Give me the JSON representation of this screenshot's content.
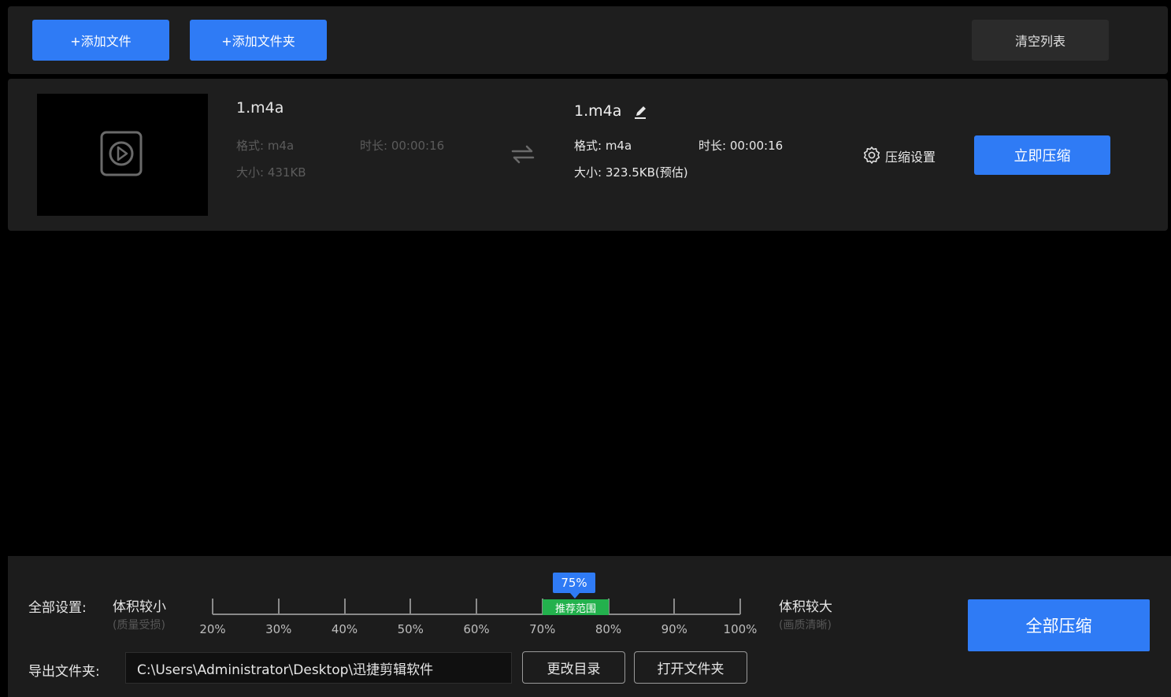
{
  "toolbar": {
    "add_file_label": "+添加文件",
    "add_folder_label": "+添加文件夹",
    "clear_list_label": "清空列表"
  },
  "file": {
    "source": {
      "name": "1.m4a",
      "format": "格式: m4a",
      "duration": "时长: 00:00:16",
      "size": "大小: 431KB"
    },
    "output": {
      "name": "1.m4a",
      "format": "格式: m4a",
      "duration": "时长: 00:00:16",
      "size": "大小: 323.5KB(预估)"
    },
    "compress_settings_label": "压缩设置",
    "compress_now_label": "立即压缩"
  },
  "bottom": {
    "all_settings_label": "全部设置:",
    "left_end_label": "体积较小",
    "left_end_sub": "(质量受损)",
    "right_end_label": "体积较大",
    "right_end_sub": "(画质清晰)",
    "slider": {
      "ticks": [
        "20%",
        "30%",
        "40%",
        "50%",
        "60%",
        "70%",
        "80%",
        "90%",
        "100%"
      ],
      "value_label": "75%",
      "value": 75,
      "recommended_label": "推荐范围"
    },
    "export_folder_label": "导出文件夹:",
    "export_path": "C:\\Users\\Administrator\\Desktop\\迅捷剪辑软件",
    "change_dir_label": "更改目录",
    "open_folder_label": "打开文件夹",
    "compress_all_label": "全部压缩"
  },
  "colors": {
    "accent": "#2f7bf5",
    "recommended": "#23b14d",
    "panel": "#1e1e1e",
    "background": "#000000"
  }
}
